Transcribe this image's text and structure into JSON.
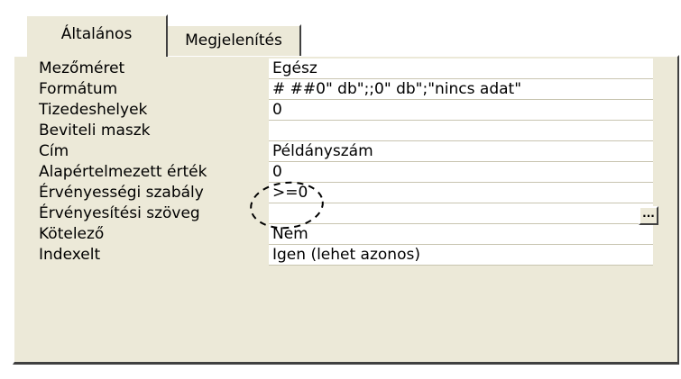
{
  "tabs": [
    {
      "label": "Általános",
      "active": true
    },
    {
      "label": "Megjelenítés",
      "active": false
    }
  ],
  "properties": [
    {
      "label": "Mezőméret",
      "value": "Egész"
    },
    {
      "label": "Formátum",
      "value": "# ##0\" db\";;0\" db\";\"nincs adat\""
    },
    {
      "label": "Tizedeshelyek",
      "value": "0"
    },
    {
      "label": "Beviteli maszk",
      "value": ""
    },
    {
      "label": "Cím",
      "value": "Példányszám"
    },
    {
      "label": "Alapértelmezett érték",
      "value": "0"
    },
    {
      "label": "Érvényességi szabály",
      "value": ">=0"
    },
    {
      "label": "Érvényesítési szöveg",
      "value": ""
    },
    {
      "label": "Kötelező",
      "value": "Nem"
    },
    {
      "label": "Indexelt",
      "value": "Igen (lehet azonos)"
    }
  ],
  "builder_button_label": "...",
  "colors": {
    "panel_bg": "#ece9d8",
    "field_bg": "#ffffff",
    "annotation": "#000000"
  }
}
